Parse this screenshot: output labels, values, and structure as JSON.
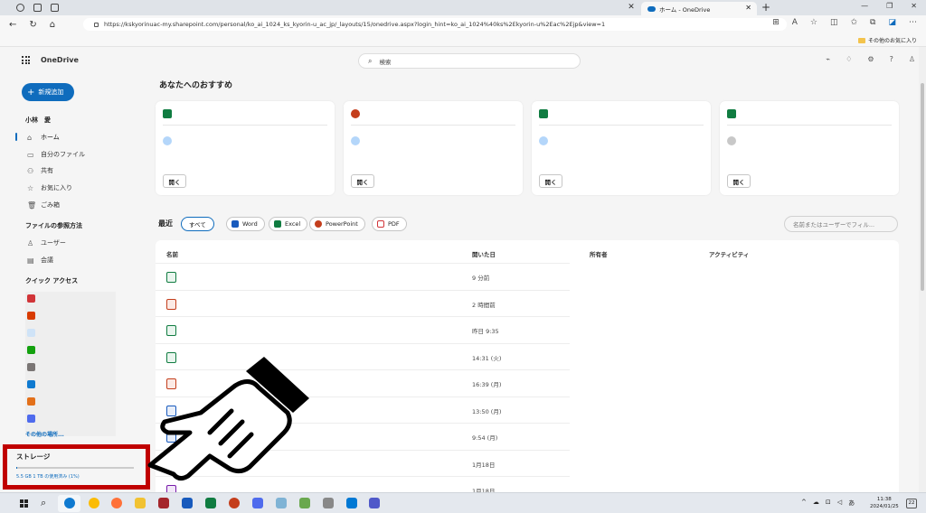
{
  "browser": {
    "tab_title": "ホーム - OneDrive",
    "url": "https://kskyorinuac-my.sharepoint.com/personal/ko_ai_1024_ks_kyorin-u_ac_jp/_layouts/15/onedrive.aspx?login_hint=ko_ai_1024%40ks%2Ekyorin-u%2Eac%2Ejp&view=1",
    "favorites_folder": "その他のお気に入り"
  },
  "app": {
    "name": "OneDrive",
    "search_placeholder": "検索"
  },
  "sidebar": {
    "new_button": "新規追加",
    "user_name": "小林　愛",
    "items": [
      {
        "label": "ホーム",
        "icon": "home-icon"
      },
      {
        "label": "自分のファイル",
        "icon": "folder-icon"
      },
      {
        "label": "共有",
        "icon": "people-icon"
      },
      {
        "label": "お気に入り",
        "icon": "star-icon"
      },
      {
        "label": "ごみ箱",
        "icon": "trash-icon"
      }
    ],
    "browse_section": "ファイルの参照方法",
    "browse_items": [
      {
        "label": "ユーザー",
        "icon": "person-icon"
      },
      {
        "label": "会議",
        "icon": "calendar-icon"
      }
    ],
    "quick_access_title": "クイック アクセス",
    "more_places": "その他の場所...",
    "storage": {
      "title": "ストレージ",
      "usage_text": "5.5 GB 1 TB の使用済み (1%)",
      "used_fraction": 0.01
    }
  },
  "recommendations": {
    "title": "あなたへのおすすめ",
    "open_label": "開く",
    "cards": [
      {
        "file_icon": "excel-icon",
        "color": "#107c41"
      },
      {
        "file_icon": "powerpoint-icon",
        "color": "#c43e1c"
      },
      {
        "file_icon": "excel-icon",
        "color": "#107c41"
      },
      {
        "file_icon": "excel-icon",
        "color": "#107c41"
      }
    ]
  },
  "recent": {
    "label": "最近",
    "filters": [
      "すべて",
      "Word",
      "Excel",
      "PowerPoint",
      "PDF"
    ],
    "filter_placeholder": "名前またはユーザーでフィル...",
    "columns": [
      "名前",
      "開いた日",
      "所有者",
      "アクティビティ"
    ],
    "rows": [
      {
        "icon": "excel-icon",
        "color": "#107c41",
        "opened": "9 分前"
      },
      {
        "icon": "powerpoint-icon",
        "color": "#c43e1c",
        "opened": "2 時間前"
      },
      {
        "icon": "excel-icon",
        "color": "#107c41",
        "opened": "昨日 9:35"
      },
      {
        "icon": "excel-icon",
        "color": "#107c41",
        "opened": "14:31 (火)"
      },
      {
        "icon": "powerpoint-icon",
        "color": "#c43e1c",
        "opened": "16:39 (月)"
      },
      {
        "icon": "word-icon",
        "color": "#185abd",
        "opened": "13:50 (月)"
      },
      {
        "icon": "word-icon",
        "color": "#185abd",
        "opened": "9:54 (月)"
      },
      {
        "icon": "list-icon",
        "color": "#d83b01",
        "opened": "1月18日"
      },
      {
        "icon": "onenote-icon",
        "color": "#7719aa",
        "opened": "1月18日"
      }
    ]
  },
  "taskbar": {
    "time": "11:38",
    "date": "2024/01/25",
    "notifications": "22",
    "ime": "あ"
  },
  "colors": {
    "accent": "#0f6cbd",
    "highlight_box": "#c00000"
  }
}
